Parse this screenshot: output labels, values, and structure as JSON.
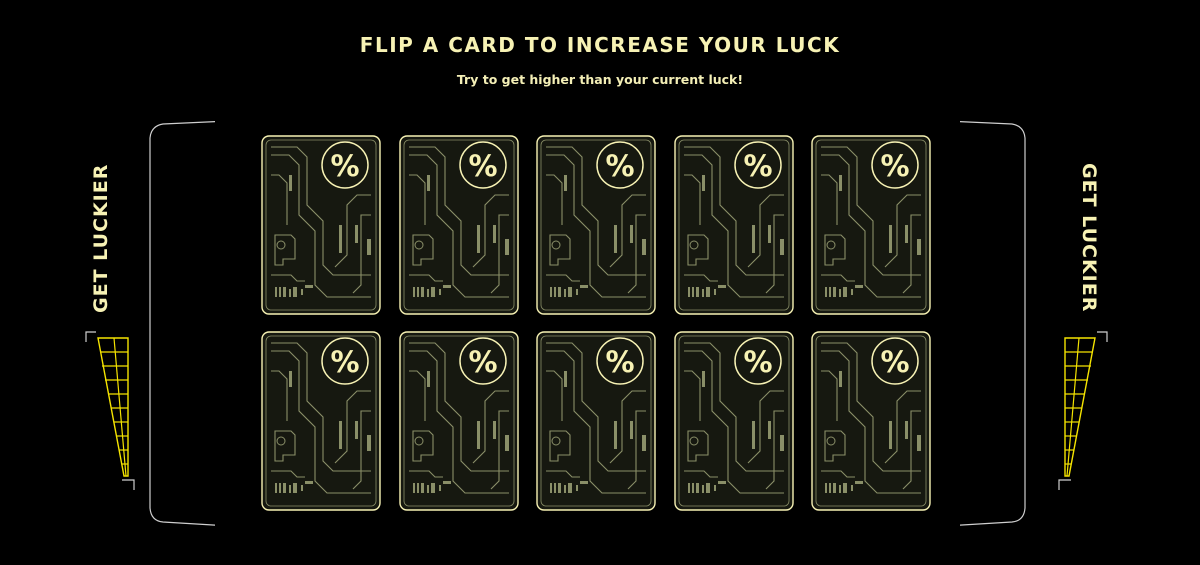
{
  "header": {
    "title": "FLIP A CARD TO INCREASE YOUR LUCK",
    "subtitle": "Try to get higher than your current luck!"
  },
  "sidebars": {
    "left_label": "GET LUCKIER",
    "right_label": "GET LUCKIER"
  },
  "cards": {
    "symbol": "%",
    "rows": 2,
    "columns": 5,
    "count": 10,
    "state": "face-down"
  },
  "colors": {
    "background": "#000000",
    "accent": "#f7f2b4",
    "card_fill": "#161810",
    "card_circuit": "#8a8f68",
    "meter_yellow": "#f5e400"
  }
}
